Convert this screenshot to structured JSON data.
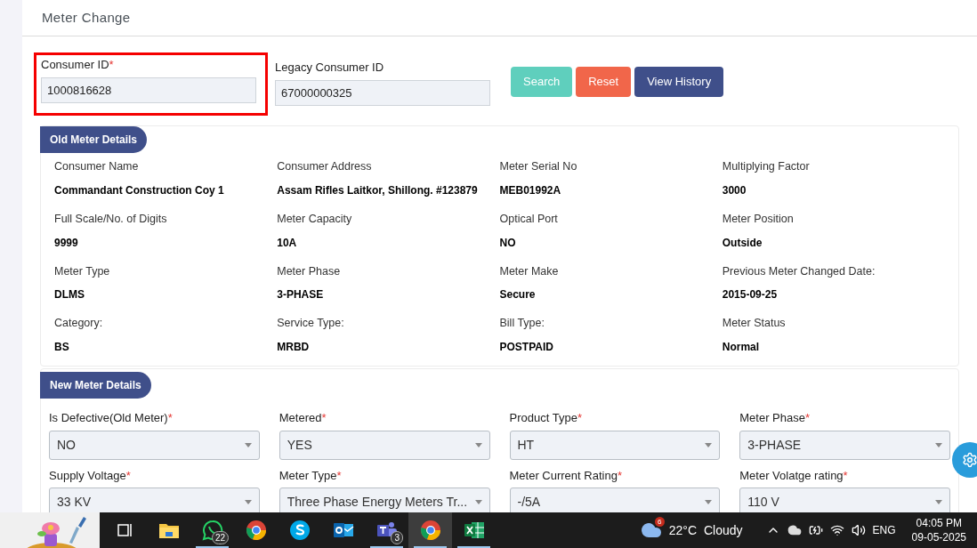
{
  "page": {
    "title": "Meter Change"
  },
  "search_form": {
    "fields": [
      {
        "label": "Consumer ID",
        "required_mark": "*",
        "value": "1000816628",
        "highlighted": true
      },
      {
        "label": "Legacy Consumer ID",
        "value": "67000000325",
        "highlighted": false
      }
    ],
    "buttons": [
      {
        "label": "Search",
        "kind": "search"
      },
      {
        "label": "Reset",
        "kind": "reset"
      },
      {
        "label": "View History",
        "kind": "history"
      }
    ]
  },
  "old_meter": {
    "heading": "Old Meter Details",
    "items": [
      {
        "label": "Consumer Name",
        "value": "Commandant Construction Coy 1"
      },
      {
        "label": "Consumer Address",
        "value": "Assam Rifles Laitkor, Shillong. #123879"
      },
      {
        "label": "Meter Serial No",
        "value": "MEB01992A"
      },
      {
        "label": "Multiplying Factor",
        "value": "3000"
      },
      {
        "label": "Full Scale/No. of Digits",
        "value": "9999"
      },
      {
        "label": "Meter Capacity",
        "value": "10A"
      },
      {
        "label": "Optical Port",
        "value": "NO"
      },
      {
        "label": "Meter Position",
        "value": "Outside"
      },
      {
        "label": "Meter Type",
        "value": "DLMS"
      },
      {
        "label": "Meter Phase",
        "value": "3-PHASE"
      },
      {
        "label": "Meter Make",
        "value": "Secure"
      },
      {
        "label": "Previous Meter Changed Date:",
        "value": "2015-09-25"
      },
      {
        "label": "Category:",
        "value": "BS"
      },
      {
        "label": "Service Type:",
        "value": "MRBD"
      },
      {
        "label": "Bill Type:",
        "value": "POSTPAID"
      },
      {
        "label": "Meter Status",
        "value": "Normal"
      }
    ]
  },
  "new_meter": {
    "heading": "New Meter Details",
    "fields": [
      {
        "label": "Is Defective(Old Meter)",
        "required_mark": "*",
        "value": "NO"
      },
      {
        "label": "Metered",
        "required_mark": "*",
        "value": "YES"
      },
      {
        "label": "Product Type",
        "required_mark": "*",
        "value": "HT"
      },
      {
        "label": "Meter Phase",
        "required_mark": "*",
        "value": "3-PHASE"
      },
      {
        "label": "Supply Voltage",
        "required_mark": "*",
        "value": "33 KV"
      },
      {
        "label": "Meter Type",
        "required_mark": "*",
        "value": "Three Phase Energy Meters Tr..."
      },
      {
        "label": "Meter Current Rating",
        "required_mark": "*",
        "value": "-/5A"
      },
      {
        "label": "Meter Volatge rating",
        "required_mark": "*",
        "value": "110 V"
      }
    ]
  },
  "taskbar": {
    "apps": [
      {
        "kind": "taskview",
        "running": false,
        "selected": false
      },
      {
        "kind": "files",
        "running": false,
        "selected": false
      },
      {
        "kind": "whatsapp",
        "badge": "22",
        "running": true,
        "selected": false
      },
      {
        "kind": "chrome",
        "running": false,
        "selected": false
      },
      {
        "kind": "skype",
        "running": false,
        "selected": false
      },
      {
        "kind": "outlook",
        "running": false,
        "selected": false
      },
      {
        "kind": "teams",
        "badge": "3",
        "running": true,
        "selected": false
      },
      {
        "kind": "chrome-profile",
        "running": true,
        "selected": true
      },
      {
        "kind": "excel",
        "running": true,
        "selected": false
      }
    ],
    "weather": {
      "badge": "6",
      "temperature": "22°C",
      "condition": "Cloudy"
    },
    "language": "ENG",
    "time": "04:05 PM",
    "date": "09-05-2025"
  }
}
